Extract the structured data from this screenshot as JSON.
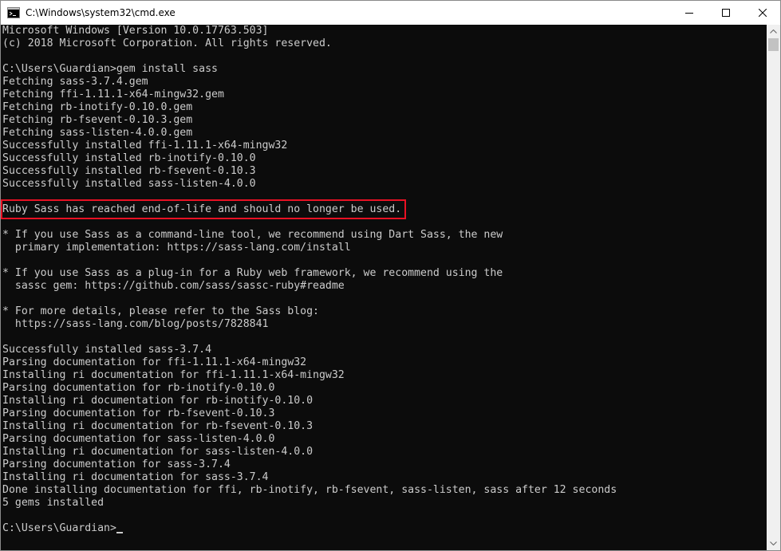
{
  "window": {
    "title": "C:\\Windows\\system32\\cmd.exe",
    "icon": "cmd-icon"
  },
  "console": {
    "lines": [
      "Microsoft Windows [Version 10.0.17763.503]",
      "(c) 2018 Microsoft Corporation. All rights reserved.",
      "",
      "C:\\Users\\Guardian>gem install sass",
      "Fetching sass-3.7.4.gem",
      "Fetching ffi-1.11.1-x64-mingw32.gem",
      "Fetching rb-inotify-0.10.0.gem",
      "Fetching rb-fsevent-0.10.3.gem",
      "Fetching sass-listen-4.0.0.gem",
      "Successfully installed ffi-1.11.1-x64-mingw32",
      "Successfully installed rb-inotify-0.10.0",
      "Successfully installed rb-fsevent-0.10.3",
      "Successfully installed sass-listen-4.0.0",
      "",
      "Ruby Sass has reached end-of-life and should no longer be used.",
      "",
      "* If you use Sass as a command-line tool, we recommend using Dart Sass, the new",
      "  primary implementation: https://sass-lang.com/install",
      "",
      "* If you use Sass as a plug-in for a Ruby web framework, we recommend using the",
      "  sassc gem: https://github.com/sass/sassc-ruby#readme",
      "",
      "* For more details, please refer to the Sass blog:",
      "  https://sass-lang.com/blog/posts/7828841",
      "",
      "Successfully installed sass-3.7.4",
      "Parsing documentation for ffi-1.11.1-x64-mingw32",
      "Installing ri documentation for ffi-1.11.1-x64-mingw32",
      "Parsing documentation for rb-inotify-0.10.0",
      "Installing ri documentation for rb-inotify-0.10.0",
      "Parsing documentation for rb-fsevent-0.10.3",
      "Installing ri documentation for rb-fsevent-0.10.3",
      "Parsing documentation for sass-listen-4.0.0",
      "Installing ri documentation for sass-listen-4.0.0",
      "Parsing documentation for sass-3.7.4",
      "Installing ri documentation for sass-3.7.4",
      "Done installing documentation for ffi, rb-inotify, rb-fsevent, sass-listen, sass after 12 seconds",
      "5 gems installed",
      "",
      "C:\\Users\\Guardian>"
    ],
    "highlighted_line_index": 14,
    "highlight_color": "#e81123",
    "text_color": "#cccccc",
    "background_color": "#0c0c0c"
  }
}
